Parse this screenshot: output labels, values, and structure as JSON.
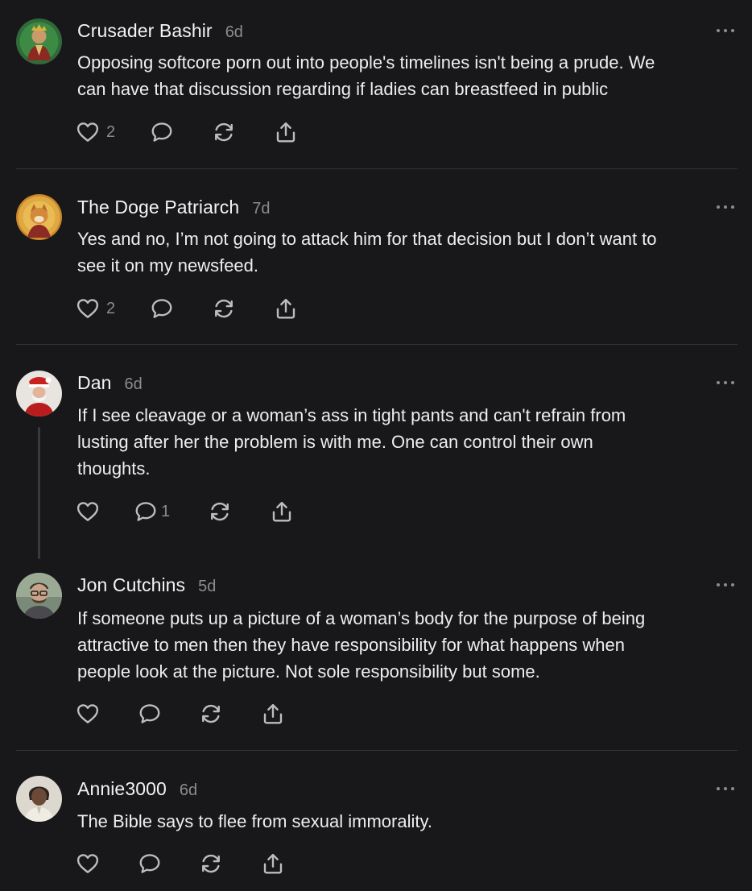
{
  "comments": [
    {
      "name": "Crusader Bashir",
      "time": "6d",
      "text": "Opposing softcore porn out into people's timelines isn't being a prude. We\ncan have that discussion regarding if ladies can breastfeed in public",
      "likes": "2",
      "replies": ""
    },
    {
      "name": "The Doge Patriarch",
      "time": "7d",
      "text": "Yes and no, I’m not going to attack him for that decision but I don’t want to\nsee it on my newsfeed.",
      "likes": "2",
      "replies": ""
    },
    {
      "name": "Dan",
      "time": "6d",
      "text": "If I see cleavage or a woman’s ass in tight pants and can't refrain from\nlusting after her the problem is with me. One can control their own\nthoughts.",
      "likes": "",
      "replies": "1"
    },
    {
      "name": "Jon Cutchins",
      "time": "5d",
      "text": "If someone puts up a picture of a woman’s body for the purpose of being\nattractive to men then they have responsibility for what happens when\npeople look at the picture. Not sole responsibility but some.",
      "likes": "",
      "replies": ""
    },
    {
      "name": "Annie3000",
      "time": "6d",
      "text": "The Bible says to flee from sexual immorality.",
      "likes": "",
      "replies": ""
    }
  ],
  "icons": {
    "like": "heart-icon",
    "reply": "comment-icon",
    "restack": "restack-icon",
    "share": "share-icon",
    "more": "more-icon"
  },
  "colors": {
    "background": "#18181a",
    "text": "#eeeeee",
    "muted": "#8c8c8e",
    "divider": "#343436"
  }
}
